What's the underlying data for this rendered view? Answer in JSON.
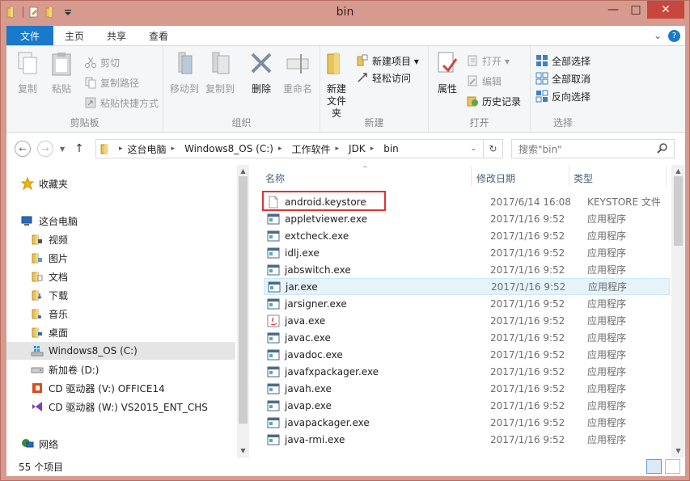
{
  "window": {
    "title": "bin",
    "minimize": "—",
    "maximize": "□",
    "close": "✕"
  },
  "tabs": [
    {
      "label": "文件"
    },
    {
      "label": "主页"
    },
    {
      "label": "共享"
    },
    {
      "label": "查看"
    }
  ],
  "tabs_right": {
    "expand": "⌄",
    "help": "?"
  },
  "ribbon": {
    "clipboard": {
      "label": "剪贴板",
      "copy": "复制",
      "paste": "粘贴",
      "cut": "剪切",
      "copy_path": "复制路径",
      "paste_shortcut": "粘贴快捷方式"
    },
    "organize": {
      "label": "组织",
      "move_to": "移动到",
      "copy_to": "复制到",
      "delete": "删除",
      "rename": "重命名"
    },
    "new": {
      "label": "新建",
      "new_folder_1": "新建",
      "new_folder_2": "文件夹",
      "new_item": "新建项目 ▾",
      "easy_access": "轻松访问"
    },
    "open": {
      "label": "打开",
      "properties": "属性",
      "open": "打开 ▾",
      "edit": "编辑",
      "history": "历史记录"
    },
    "select": {
      "label": "选择",
      "select_all": "全部选择",
      "select_none": "全部取消",
      "invert": "反向选择"
    }
  },
  "navbar": {
    "back": "←",
    "forward": "→",
    "up": "↑",
    "breadcrumb": [
      "这台电脑",
      "Windows8_OS (C:)",
      "工作软件",
      "JDK",
      "bin"
    ],
    "refresh": "↻",
    "search_placeholder": "搜索\"bin\""
  },
  "nav_pane": {
    "favorites": "收藏夹",
    "this_pc": "这台电脑",
    "items": [
      "视频",
      "图片",
      "文档",
      "下载",
      "音乐",
      "桌面"
    ],
    "drives": [
      "Windows8_OS (C:)",
      "新加卷 (D:)",
      "CD 驱动器 (V:) OFFICE14",
      "CD 驱动器 (W:) VS2015_ENT_CHS"
    ],
    "network": "网络"
  },
  "columns": {
    "name": "名称",
    "date": "修改日期",
    "type": "类型"
  },
  "files": [
    {
      "name": "android.keystore",
      "date": "2017/6/14 16:08",
      "type": "KEYSTORE 文件"
    },
    {
      "name": "appletviewer.exe",
      "date": "2017/1/16 9:52",
      "type": "应用程序"
    },
    {
      "name": "extcheck.exe",
      "date": "2017/1/16 9:52",
      "type": "应用程序"
    },
    {
      "name": "idlj.exe",
      "date": "2017/1/16 9:52",
      "type": "应用程序"
    },
    {
      "name": "jabswitch.exe",
      "date": "2017/1/16 9:52",
      "type": "应用程序"
    },
    {
      "name": "jar.exe",
      "date": "2017/1/16 9:52",
      "type": "应用程序"
    },
    {
      "name": "jarsigner.exe",
      "date": "2017/1/16 9:52",
      "type": "应用程序"
    },
    {
      "name": "java.exe",
      "date": "2017/1/16 9:52",
      "type": "应用程序"
    },
    {
      "name": "javac.exe",
      "date": "2017/1/16 9:52",
      "type": "应用程序"
    },
    {
      "name": "javadoc.exe",
      "date": "2017/1/16 9:52",
      "type": "应用程序"
    },
    {
      "name": "javafxpackager.exe",
      "date": "2017/1/16 9:52",
      "type": "应用程序"
    },
    {
      "name": "javah.exe",
      "date": "2017/1/16 9:52",
      "type": "应用程序"
    },
    {
      "name": "javap.exe",
      "date": "2017/1/16 9:52",
      "type": "应用程序"
    },
    {
      "name": "javapackager.exe",
      "date": "2017/1/16 9:52",
      "type": "应用程序"
    },
    {
      "name": "java-rmi.exe",
      "date": "2017/1/16 9:52",
      "type": "应用程序"
    }
  ],
  "status": {
    "count": "55 个项目"
  },
  "colors": {
    "accent": "#1979ca",
    "titlebar": "#d79a8e",
    "highlight": "#e53131",
    "selection": "#e5f3fb"
  }
}
